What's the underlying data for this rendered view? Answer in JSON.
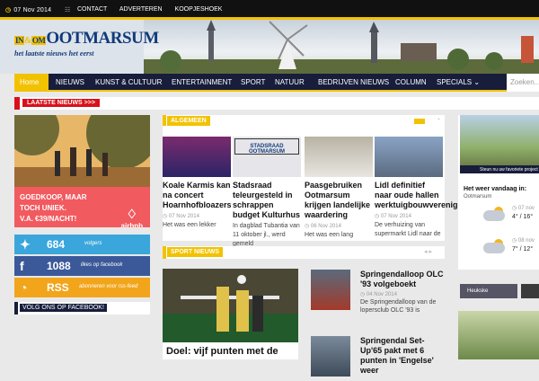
{
  "topbar": {
    "date": "07 Nov 2014",
    "menu": [
      "CONTACT",
      "ADVERTEREN",
      "KOOPJESHOEK"
    ]
  },
  "logo": {
    "prefix_top": "IN",
    "prefix_amp": "&",
    "prefix_bot": "OM",
    "name": "OOTMARSUM",
    "tagline": "het laatste nieuws het eerst"
  },
  "nav": {
    "home": "Home",
    "items": [
      "NIEUWS",
      "KUNST & CULTUUR",
      "ENTERTAINMENT",
      "SPORT",
      "NATUUR",
      "BEDRIJVEN NIEUWS",
      "COLUMN",
      "SPECIALS"
    ],
    "search_placeholder": "Zoeken..."
  },
  "ticker": {
    "label": "LAATSTE NIEUWS >>>"
  },
  "ad": {
    "text_line1": "GOEDKOOP, MAAR",
    "text_line2": "TOCH UNIEK.",
    "text_line3": "V.A. €39/NACHT!",
    "brand": "airbnb"
  },
  "social": [
    {
      "name": "twitter",
      "count": "684",
      "label": "volgers",
      "color": "#3aa6dc"
    },
    {
      "name": "facebook",
      "count": "1088",
      "label": "likes op facebook",
      "color": "#3b5998"
    },
    {
      "name": "rss",
      "count": "RSS",
      "label": "abonneren voor rss-feed",
      "color": "#f2a51b"
    }
  ],
  "follow_label": "VOLG ONS OP FACEBOOK!",
  "sections": {
    "algemeen": "ALGEMEEN",
    "sport": "SPORT NIEUWS"
  },
  "cards": [
    {
      "title": "Koale Karmis kan na concert Hoarnhofbloazers",
      "date": "07 Nov 2014",
      "excerpt": "Het was een lekker",
      "img": "#7a2b6e"
    },
    {
      "title": "Stadsraad teleurgesteld in schrappen budget Kulturhus",
      "date": "",
      "excerpt": "In dagblad Tubantia van 11 oktober jl., werd gemeld",
      "img": "#e6e6ea",
      "img_label": "STADSRAAD OOTMARSUM"
    },
    {
      "title": "Paasgebruiken Ootmarsum krijgen landelijke waardering",
      "date": "06 Nov 2014",
      "excerpt": "Het was een lang",
      "img": "#d9d4c7"
    },
    {
      "title": "Lidl definitief naar oude hallen werktuigbouwvereniging",
      "date": "07 Nov 2014",
      "excerpt": "De verhuizing van supermarkt Lidl naar de",
      "img": "#8aa3c4"
    }
  ],
  "sport_main": {
    "title": "Doel: vijf punten met de"
  },
  "sport_list": [
    {
      "title": "Springendalloop OLC '93 volgeboekt",
      "date": "04 Nov 2014",
      "excerpt": "De Springendalloop van de lopersclub OLC '93 is"
    },
    {
      "title": "Springendal Set-Up'65 pakt met 6 punten in 'Engelse' weer",
      "date": "",
      "excerpt": ""
    }
  ],
  "weather": {
    "banner": "Steun nu uw favoriete project",
    "heading": "Het weer vandaag in:",
    "location": "Ootmarsum",
    "days": [
      {
        "date": "07 nov",
        "temp": "4° / 16°"
      },
      {
        "date": "08 nov",
        "temp": "7° / 12°"
      }
    ]
  },
  "right_box_label": "Heukske"
}
